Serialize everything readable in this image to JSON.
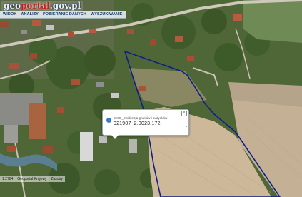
{
  "header": {
    "logo": {
      "part1": "geo",
      "part2": "portal",
      "part3": ".gov.pl"
    },
    "menu": [
      {
        "label": "WIDOK"
      },
      {
        "label": "ANALIZY"
      },
      {
        "label": "POBIERANIE DANYCH"
      },
      {
        "label": "WYSZUKIWANIE"
      }
    ]
  },
  "map": {
    "parcel_outline_color": "#0e1f8a",
    "road_color": "#cfc9bc"
  },
  "popup": {
    "title": "EMiG_Ewidencja gruntów i budynków",
    "value": "021907_2.0023.172",
    "close_icon": "close-icon",
    "expand_icon": "chevron-icon"
  },
  "footer": {
    "scale": "1:2784",
    "link1": "Geoportal Krajowy",
    "link2": "Zasoby"
  }
}
